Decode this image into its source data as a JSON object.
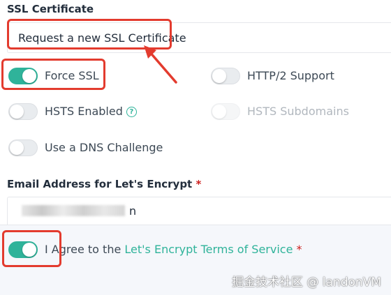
{
  "ssl_certificate": {
    "label": "SSL Certificate",
    "value": "Request a new SSL Certificate"
  },
  "toggles": {
    "force_ssl": {
      "label": "Force SSL",
      "on": true
    },
    "http2": {
      "label": "HTTP/2 Support",
      "on": false
    },
    "hsts_enabled": {
      "label": "HSTS Enabled",
      "on": false,
      "help_icon": "question-circle-icon"
    },
    "hsts_subdomains": {
      "label": "HSTS Subdomains",
      "on": false,
      "disabled": true
    },
    "dns_challenge": {
      "label": "Use a DNS Challenge",
      "on": false
    }
  },
  "email": {
    "label": "Email Address for Let's Encrypt",
    "required_mark": "*",
    "value_visible_fragment": "n"
  },
  "agree": {
    "prefix": "I Agree to the",
    "link_text": "Let's Encrypt Terms of Service",
    "required_mark": "*",
    "on": true
  },
  "annotation": {
    "color": "#e33b2e"
  },
  "colors": {
    "accent": "#2fb39a",
    "required": "#cd201f"
  },
  "watermark": "掘金技术社区 @ landonVM"
}
